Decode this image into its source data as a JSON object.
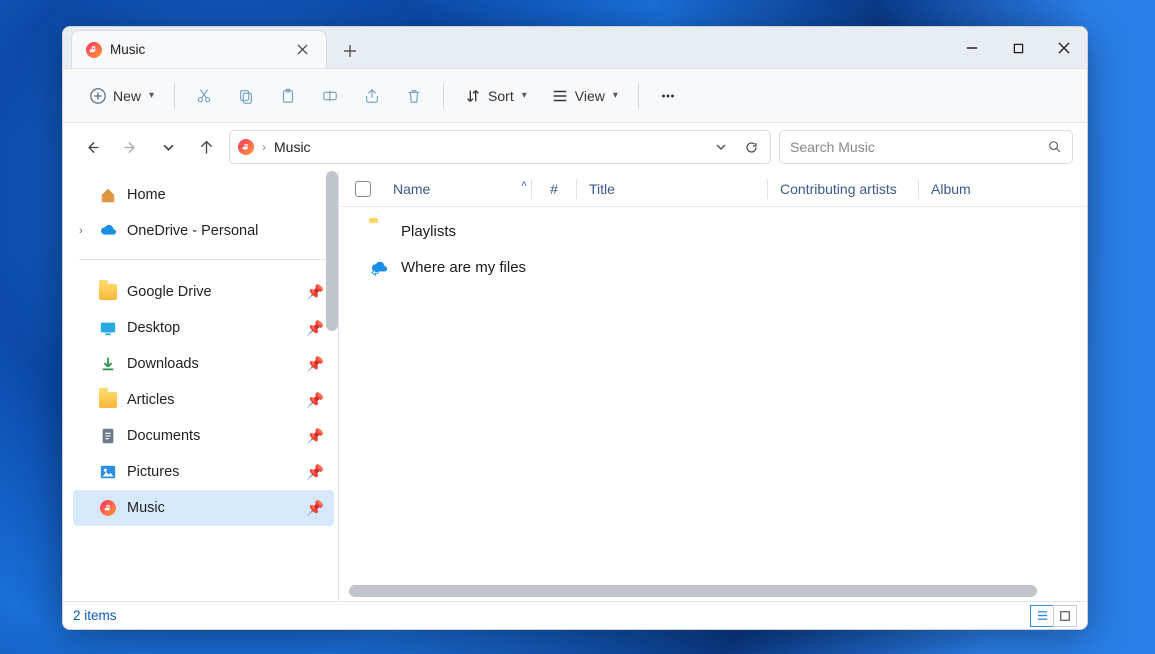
{
  "tab": {
    "title": "Music"
  },
  "toolbar": {
    "new_label": "New",
    "sort_label": "Sort",
    "view_label": "View"
  },
  "breadcrumb": {
    "location": "Music"
  },
  "search": {
    "placeholder": "Search Music"
  },
  "sidebar": {
    "home": "Home",
    "onedrive": "OneDrive - Personal",
    "pinned": [
      {
        "label": "Google Drive"
      },
      {
        "label": "Desktop"
      },
      {
        "label": "Downloads"
      },
      {
        "label": "Articles"
      },
      {
        "label": "Documents"
      },
      {
        "label": "Pictures"
      },
      {
        "label": "Music"
      }
    ]
  },
  "columns": {
    "name": "Name",
    "number": "#",
    "title": "Title",
    "artists": "Contributing artists",
    "album": "Album"
  },
  "files": [
    {
      "name": "Playlists",
      "type": "folder"
    },
    {
      "name": "Where are my files",
      "type": "cloud"
    }
  ],
  "status": {
    "text": "2 items"
  }
}
